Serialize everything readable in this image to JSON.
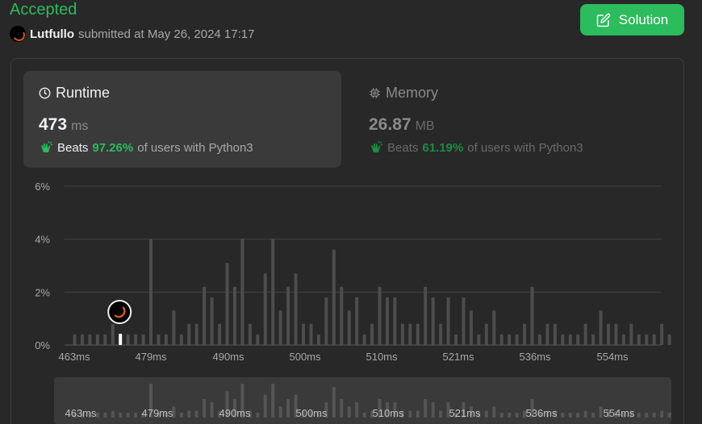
{
  "header": {
    "status": "Accepted",
    "username": "Lutfullo",
    "submitted_text": "submitted at May 26, 2024 17:17",
    "solution_label": "Solution"
  },
  "runtime": {
    "label": "Runtime",
    "value": "473",
    "unit": "ms",
    "beats_word": "Beats",
    "beats_pct": "97.26%",
    "beats_rest": "of users with Python3"
  },
  "memory": {
    "label": "Memory",
    "value": "26.87",
    "unit": "MB",
    "beats_word": "Beats",
    "beats_pct": "61.19%",
    "beats_rest": "of users with Python3"
  },
  "colors": {
    "accent_green": "#2cbb5d",
    "bar": "#4d4d4d",
    "highlight_bar": "#ffffff",
    "avatar_ring": "#d5561c"
  },
  "chart_data": {
    "type": "bar",
    "ylim": [
      0,
      6
    ],
    "yticks": [
      "6%",
      "4%",
      "2%",
      "0%"
    ],
    "xticks": [
      "463ms",
      "479ms",
      "490ms",
      "500ms",
      "510ms",
      "521ms",
      "536ms",
      "554ms"
    ],
    "highlight_index": 6,
    "highlight_value": "473ms",
    "values": [
      0.4,
      0.4,
      0.4,
      0.4,
      0.4,
      0.8,
      0.4,
      0.4,
      0.4,
      0.4,
      4.0,
      0.4,
      0.4,
      1.3,
      0.4,
      0.8,
      0.8,
      2.2,
      1.8,
      0.8,
      3.1,
      2.2,
      4.0,
      0.8,
      0.4,
      2.7,
      4.0,
      1.3,
      2.2,
      2.7,
      0.8,
      0.8,
      0.4,
      1.8,
      3.6,
      2.2,
      1.3,
      1.8,
      0.4,
      0.8,
      2.2,
      1.8,
      1.8,
      0.8,
      0.8,
      0.8,
      2.2,
      1.8,
      0.8,
      1.8,
      0.4,
      1.8,
      1.3,
      0.4,
      0.8,
      1.3,
      0.4,
      0.4,
      0.4,
      0.8,
      2.2,
      0.4,
      0.8,
      0.8,
      0.4,
      0.4,
      0.4,
      0.8,
      0.4,
      1.3,
      0.8,
      0.8,
      0.4,
      0.8,
      0.4,
      0.4,
      0.4,
      0.8,
      0.4
    ]
  }
}
